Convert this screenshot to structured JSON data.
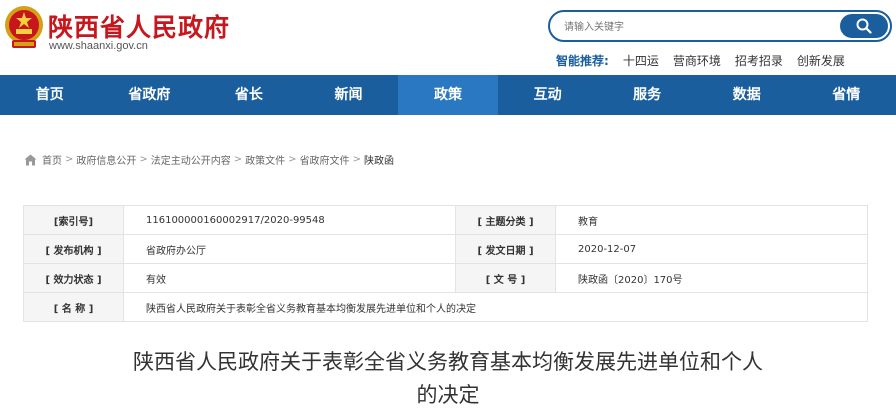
{
  "header": {
    "site_title": "陕西省人民政府",
    "site_url": "www.shaanxi.gov.cn",
    "logo_icon": "national-emblem-icon"
  },
  "search": {
    "placeholder": "请输入关键字",
    "button_icon": "search-icon"
  },
  "hot": {
    "label": "智能推荐:",
    "items": [
      "十四运",
      "营商环境",
      "招考招录",
      "创新发展"
    ]
  },
  "nav": {
    "items": [
      "首页",
      "省政府",
      "省长",
      "新闻",
      "政策",
      "互动",
      "服务",
      "数据",
      "省情"
    ],
    "active": "政策"
  },
  "breadcrumb": {
    "home_icon": "home-icon",
    "items": [
      "首页",
      "政府信息公开",
      "法定主动公开内容",
      "政策文件",
      "省政府文件",
      "陕政函"
    ],
    "separator": ">"
  },
  "info": {
    "index_label": "[索引号]",
    "index_value": "116100000160002917/2020-99548",
    "category_label": "[ 主题分类 ]",
    "category_value": "教育",
    "issuer_label": "[ 发布机构 ]",
    "issuer_value": "省政府办公厅",
    "date_label": "[ 发文日期 ]",
    "date_value": "2020-12-07",
    "status_label": "[ 效力状态 ]",
    "status_value": "有效",
    "docno_label": "[ 文 号 ]",
    "docno_value": "陕政函〔2020〕170号",
    "name_label": "[ 名 称 ]",
    "name_value": "陕西省人民政府关于表彰全省义务教育基本均衡发展先进单位和个人的决定"
  },
  "document": {
    "title_line1": "陕西省人民政府关于表彰全省义务教育基本均衡发展先进单位和个人",
    "title_line2": "的决定"
  },
  "colors": {
    "brand_red": "#c8161d",
    "nav_blue": "#1a5e9e",
    "nav_active": "#2b78c2"
  }
}
